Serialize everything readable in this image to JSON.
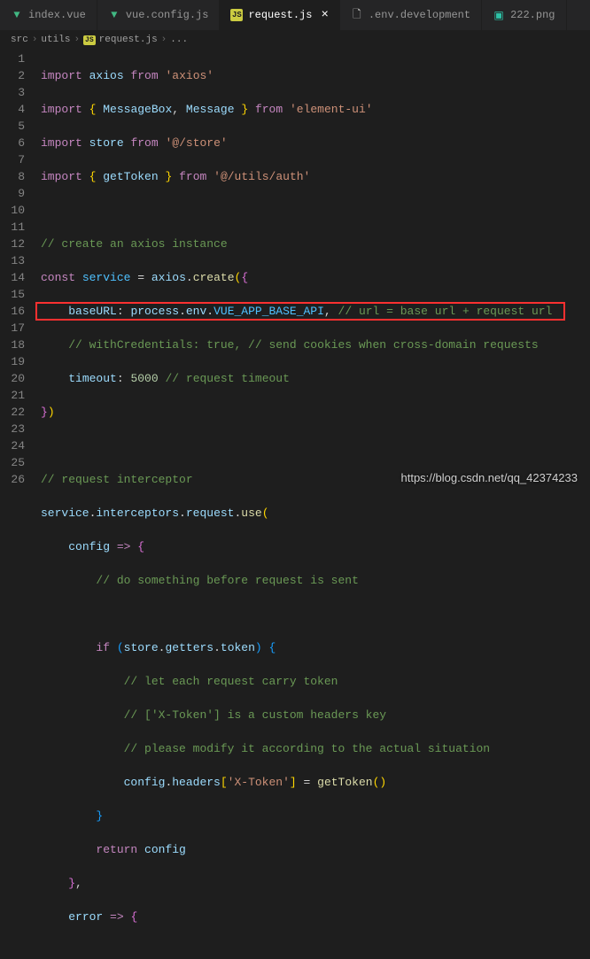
{
  "tabs": [
    {
      "label": "index.vue",
      "icon": "vue"
    },
    {
      "label": "vue.config.js",
      "icon": "vue"
    },
    {
      "label": "request.js",
      "icon": "js",
      "active": true
    },
    {
      "label": ".env.development",
      "icon": "file"
    },
    {
      "label": "222.png",
      "icon": "img"
    }
  ],
  "breadcrumb": {
    "p1": "src",
    "p2": "utils",
    "p3": "request.js",
    "p4": "...",
    "icon_label": "JS"
  },
  "code": {
    "l1": {
      "import": "import",
      "axios": "axios",
      "from": "from",
      "axios_str": "'axios'"
    },
    "l2": {
      "import": "import",
      "mb": "MessageBox",
      "msg": "Message",
      "from": "from",
      "elui": "'element-ui'"
    },
    "l3": {
      "import": "import",
      "store": "store",
      "from": "from",
      "path": "'@/store'"
    },
    "l4": {
      "import": "import",
      "gt": "getToken",
      "from": "from",
      "path": "'@/utils/auth'"
    },
    "l6": {
      "cm": "// create an axios instance"
    },
    "l7": {
      "const": "const",
      "service": "service",
      "axios": "axios",
      "create": "create"
    },
    "l8": {
      "baseURL": "baseURL",
      "process": "process",
      "env": "env",
      "api": "VUE_APP_BASE_API",
      "cm": "// url = base url + request url"
    },
    "l9": {
      "cm": "// withCredentials: true, // send cookies when cross-domain requests"
    },
    "l10": {
      "timeout": "timeout",
      "val": "5000",
      "cm": "// request timeout"
    },
    "l13": {
      "cm": "// request interceptor"
    },
    "l14": {
      "service": "service",
      "interceptors": "interceptors",
      "request": "request",
      "use": "use"
    },
    "l15": {
      "config": "config"
    },
    "l16": {
      "cm": "// do something before request is sent"
    },
    "l18": {
      "if": "if",
      "store": "store",
      "getters": "getters",
      "token": "token"
    },
    "l19": {
      "cm": "// let each request carry token"
    },
    "l20": {
      "cm": "// ['X-Token'] is a custom headers key"
    },
    "l21": {
      "cm": "// please modify it according to the actual situation"
    },
    "l22": {
      "config": "config",
      "headers": "headers",
      "xtoken": "'X-Token'",
      "gt": "getToken"
    },
    "l24": {
      "return": "return",
      "config": "config"
    },
    "l26": {
      "error": "error"
    }
  },
  "watermark": "https://blog.csdn.net/qq_42374233"
}
